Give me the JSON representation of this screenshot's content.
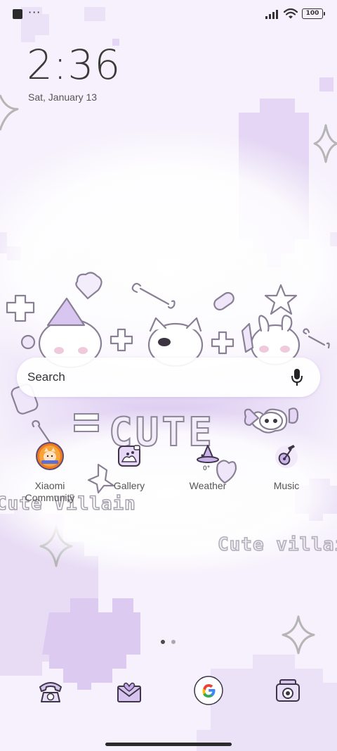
{
  "status_bar": {
    "notification_icons": [
      "app-notification-icon",
      "more-dots-icon"
    ],
    "dots": "···",
    "signal_icon": "signal-bars-icon",
    "wifi_icon": "wifi-icon",
    "battery_level": "100"
  },
  "lock": {
    "time": "2:36",
    "date": "Sat, January 13"
  },
  "search": {
    "placeholder": "Search",
    "mic_icon": "microphone-icon"
  },
  "apps": [
    {
      "label": "Xiaomi Community",
      "icon": "xiaomi-community-icon"
    },
    {
      "label": "Gallery",
      "icon": "gallery-icon"
    },
    {
      "label": "Weather",
      "icon": "weather-witch-hat-icon",
      "badge": "0°"
    },
    {
      "label": "Music",
      "icon": "guitar-icon"
    }
  ],
  "page_indicator": {
    "pages": 2,
    "current": 1
  },
  "dock": [
    {
      "icon": "telephone-icon",
      "label": "Phone"
    },
    {
      "icon": "envelope-heart-icon",
      "label": "Messages"
    },
    {
      "icon": "google-g-icon",
      "label": "Google"
    },
    {
      "icon": "camera-icon",
      "label": "Camera"
    }
  ],
  "wallpaper": {
    "text_cute": "CUTE",
    "text_villain_left": "Cute Villain",
    "text_villain_right": "Cute villain"
  },
  "colors": {
    "lavender": "#d8c6ef",
    "lavender_light": "#ece2f7",
    "outline": "#6b5e78",
    "accent": "#b69ad9"
  }
}
